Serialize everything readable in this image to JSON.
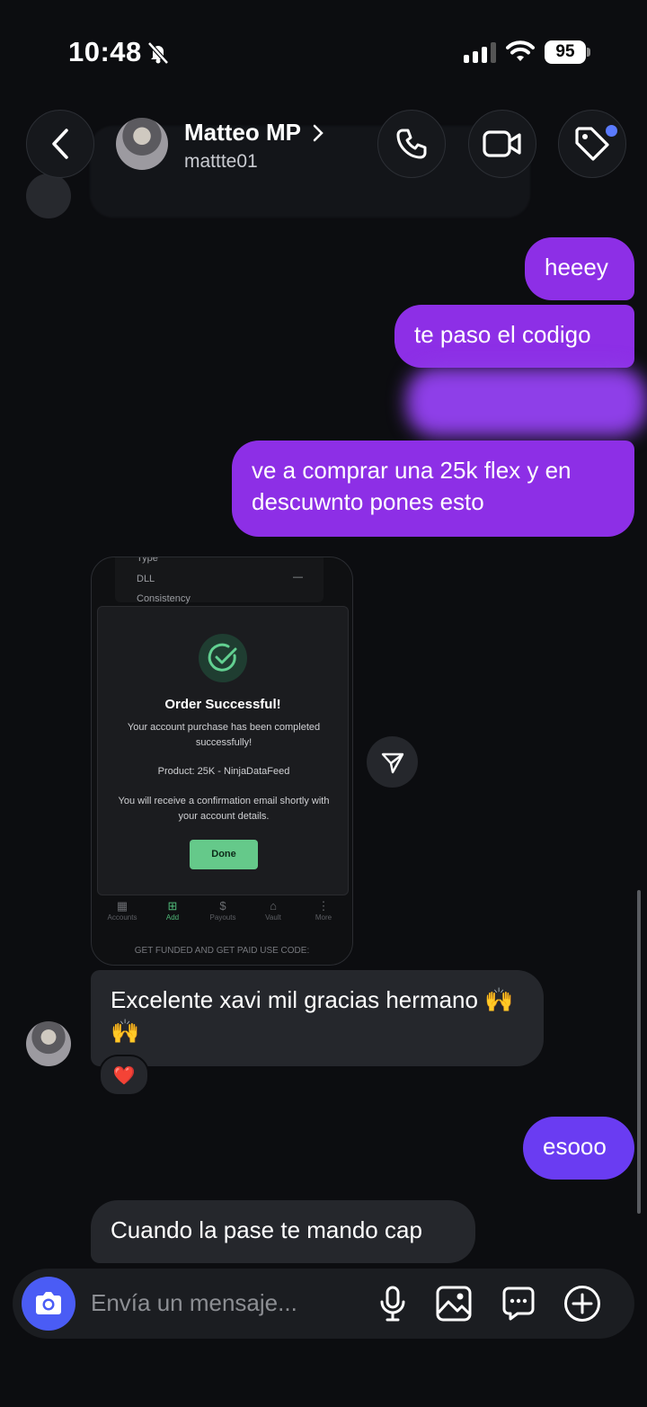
{
  "status_bar": {
    "time": "10:48",
    "battery": "95"
  },
  "header": {
    "name": "Matteo MP",
    "username": "mattte01"
  },
  "messages": {
    "m1": "heeey",
    "m2": "te paso el codigo",
    "m3": "ve a comprar una 25k flex y en descuwnto pones esto",
    "m4": "Excelente xavi mil gracias hermano 🙌🙌",
    "m4_reaction": "❤️",
    "m5": "esooo",
    "m6": "Cuando la pase te mando cap"
  },
  "shared_screenshot": {
    "rows": [
      "Type",
      "DLL",
      "Consistency"
    ],
    "dll_value": "—",
    "title": "Order Successful!",
    "line1": "Your account purchase has been completed successfully!",
    "line2": "Product: 25K - NinjaDataFeed",
    "line3": "You will receive a confirmation email shortly with your account details.",
    "button": "Done",
    "tabs": [
      "Accounts",
      "Add",
      "Payouts",
      "Vault",
      "More"
    ],
    "promo": "GET FUNDED AND GET PAID USE CODE:"
  },
  "composer": {
    "placeholder": "Envía un mensaje..."
  },
  "colors": {
    "outgoing": "#8d2fe6",
    "outgoing_alt": "#6a3cf2",
    "incoming": "#25272c",
    "camera": "#4a5cf5"
  }
}
